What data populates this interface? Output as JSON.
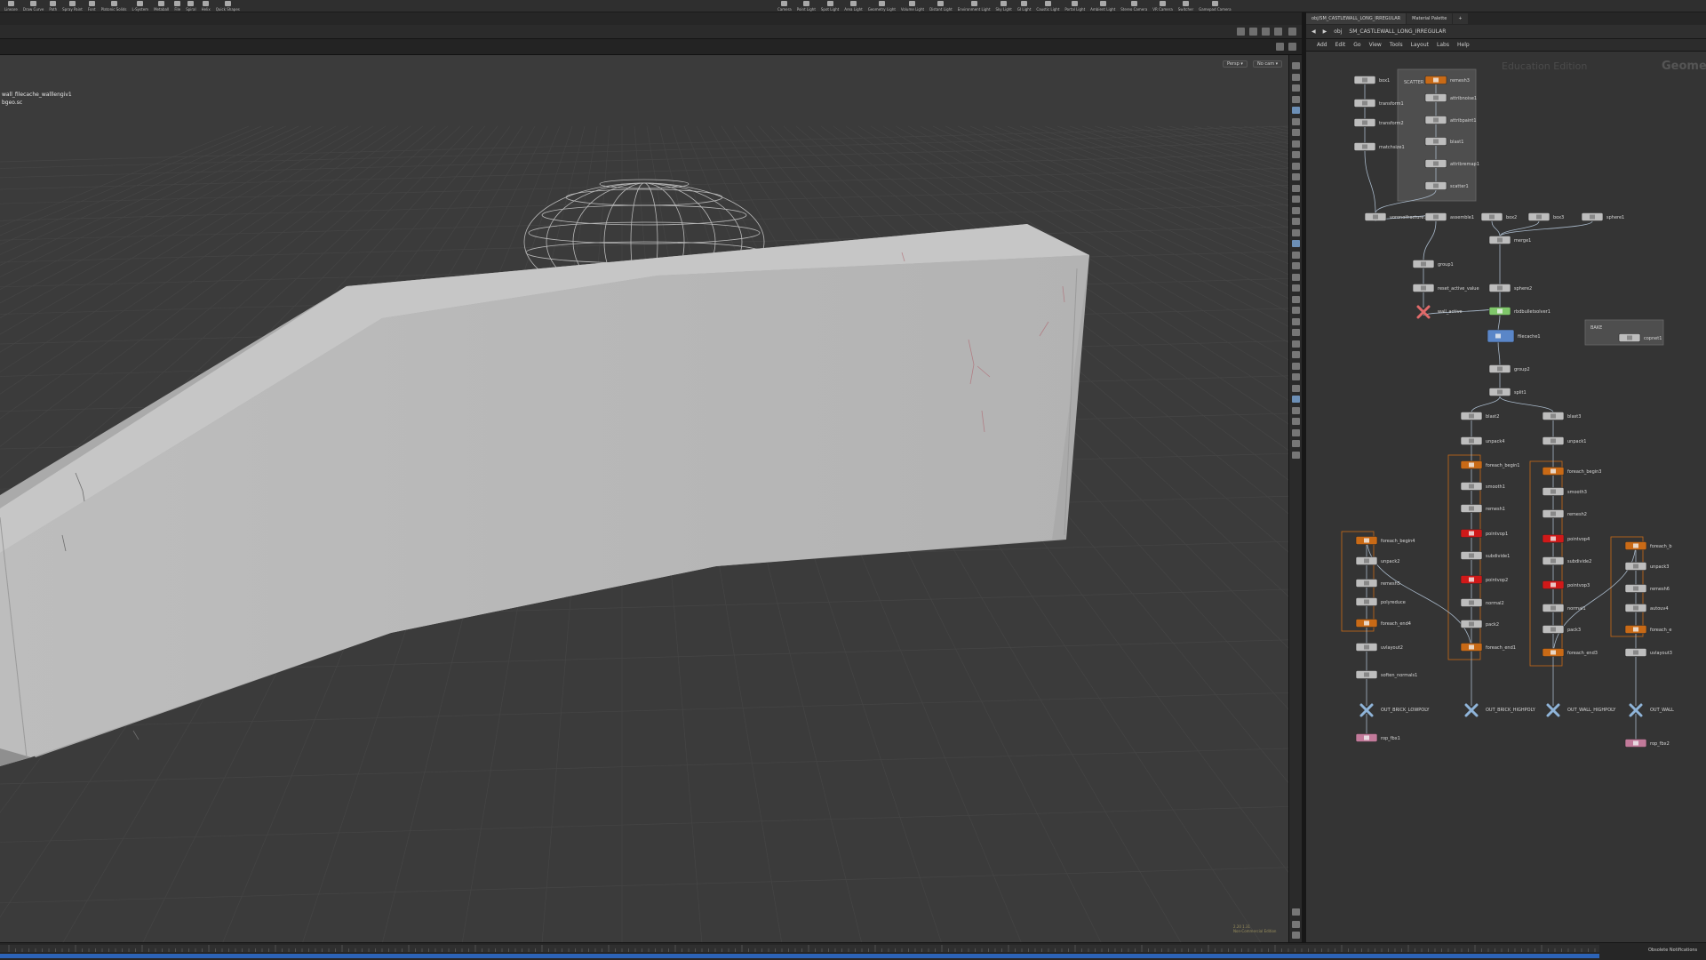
{
  "shelf": {
    "left_tools": [
      "Lineare",
      "Draw Curve",
      "Path",
      "Spray Paint",
      "Font",
      "Platonic Solids",
      "L-System",
      "Metaball",
      "File",
      "Spiral",
      "Helix",
      "Quick Shapes"
    ],
    "right_tools": [
      "Camera",
      "Point Light",
      "Spot Light",
      "Area Light",
      "Geometry Light",
      "Volume Light",
      "Distant Light",
      "Environment Light",
      "Sky Light",
      "GI Light",
      "Caustic Light",
      "Portal Light",
      "Ambient Light",
      "Stereo Camera",
      "VR Camera",
      "Switcher",
      "Gamepad Camera"
    ]
  },
  "viewport": {
    "node_info_line1": "wall_filecache_walllengiv1",
    "node_info_line2": "bgeo.sc",
    "persp_label": "Persp ▾",
    "cam_label": "No cam ▾",
    "stats_line1": "2.20   1.31",
    "stats_line2": "Non-Commercial Edition"
  },
  "network_editor": {
    "tab_1": "obj/SM_CASTLEWALL_LONG_IRREGULAR",
    "tab_2": "Material Palette",
    "path_obj": "obj",
    "path_node": "SM_CASTLEWALL_LONG_IRREGULAR",
    "menus": [
      "Add",
      "Edit",
      "Go",
      "View",
      "Tools",
      "Layout",
      "Labs",
      "Help"
    ],
    "watermark": "Education Edition",
    "context_label": "Geometry",
    "scatter_box_title": "SCATTER POINTS",
    "bake_box_title": "BAKE",
    "nodes": [
      {
        "name": "box1",
        "type": "plain"
      },
      {
        "name": "transform1",
        "type": "plain"
      },
      {
        "name": "transform2",
        "type": "plain"
      },
      {
        "name": "matchsize1",
        "type": "plain"
      },
      {
        "name": "remesh3",
        "type": "orange"
      },
      {
        "name": "attribnoise1",
        "type": "plain"
      },
      {
        "name": "attribpaint1",
        "type": "plain"
      },
      {
        "name": "blast1",
        "type": "plain"
      },
      {
        "name": "attribremap1",
        "type": "plain"
      },
      {
        "name": "scatter1",
        "type": "plain"
      },
      {
        "name": "voronoifracture1",
        "type": "plain"
      },
      {
        "name": "assemble1",
        "type": "plain"
      },
      {
        "name": "box2",
        "type": "plain"
      },
      {
        "name": "box3",
        "type": "plain"
      },
      {
        "name": "sphere1",
        "type": "plain"
      },
      {
        "name": "merge1",
        "type": "plain"
      },
      {
        "name": "group1",
        "type": "plain"
      },
      {
        "name": "reset_active_value",
        "type": "plain"
      },
      {
        "name": "sphere2",
        "type": "plain"
      },
      {
        "name": "wall_active",
        "type": "bypass"
      },
      {
        "name": "rbdbulletsolver1",
        "type": "green"
      },
      {
        "name": "filecache1",
        "type": "blue"
      },
      {
        "name": "copnet1",
        "type": "plain"
      },
      {
        "name": "group2",
        "type": "plain"
      },
      {
        "name": "split1",
        "type": "plain"
      },
      {
        "name": "blast2",
        "type": "plain"
      },
      {
        "name": "blast3",
        "type": "plain"
      },
      {
        "name": "unpack4",
        "type": "plain"
      },
      {
        "name": "unpack1",
        "type": "plain"
      },
      {
        "name": "foreach_begin1",
        "type": "orange"
      },
      {
        "name": "foreach_begin3",
        "type": "orange"
      },
      {
        "name": "smooth1",
        "type": "plain"
      },
      {
        "name": "smooth3",
        "type": "plain"
      },
      {
        "name": "remesh1",
        "type": "plain"
      },
      {
        "name": "remesh2",
        "type": "plain"
      },
      {
        "name": "pointvop1",
        "type": "red"
      },
      {
        "name": "pointvop4",
        "type": "red"
      },
      {
        "name": "subdivide1",
        "type": "plain"
      },
      {
        "name": "subdivide2",
        "type": "plain"
      },
      {
        "name": "pointvop2",
        "type": "red"
      },
      {
        "name": "pointvop3",
        "type": "red"
      },
      {
        "name": "normal2",
        "type": "plain"
      },
      {
        "name": "normal1",
        "type": "plain"
      },
      {
        "name": "pack2",
        "type": "plain"
      },
      {
        "name": "pack3",
        "type": "plain"
      },
      {
        "name": "foreach_end1",
        "type": "orange"
      },
      {
        "name": "foreach_end3",
        "type": "orange"
      },
      {
        "name": "foreach_begin4",
        "type": "orange"
      },
      {
        "name": "unpack2",
        "type": "plain"
      },
      {
        "name": "remesh5",
        "type": "plain"
      },
      {
        "name": "polyreduce",
        "type": "plain"
      },
      {
        "name": "foreach_end4",
        "type": "orange"
      },
      {
        "name": "uvlayout2",
        "type": "plain"
      },
      {
        "name": "soften_normals1",
        "type": "plain"
      },
      {
        "name": "OUT_BRICK_LOWPOLY",
        "type": "out"
      },
      {
        "name": "OUT_BRICK_HIGHPOLY",
        "type": "out"
      },
      {
        "name": "OUT_WALL_HIGHPOLY",
        "type": "out"
      },
      {
        "name": "OUT_WALL",
        "type": "out"
      },
      {
        "name": "rop_fbx1",
        "type": "rop"
      },
      {
        "name": "rop_fbx2",
        "type": "rop"
      },
      {
        "name": "foreach_b",
        "type": "orange"
      },
      {
        "name": "unpack3",
        "type": "plain"
      },
      {
        "name": "remesh6",
        "type": "plain"
      },
      {
        "name": "autouv4",
        "type": "plain"
      },
      {
        "name": "foreach_e",
        "type": "orange"
      },
      {
        "name": "uvlayout3",
        "type": "plain"
      }
    ]
  },
  "timeline": {
    "status": "Obsolete Notifications"
  },
  "colors": {
    "viewport_bg": "#3b3b3b",
    "grid": "#454545",
    "wall_face": "#bcbcbc",
    "wall_side": "#a3a3a3",
    "node_plain": "#bdbdbd",
    "node_orange": "#c96a16",
    "node_red": "#d01919",
    "node_green": "#7fc76a",
    "node_blue": "#5a86c8",
    "wire": "#a8b8c9",
    "timeline_progress": "#2c63b7"
  }
}
